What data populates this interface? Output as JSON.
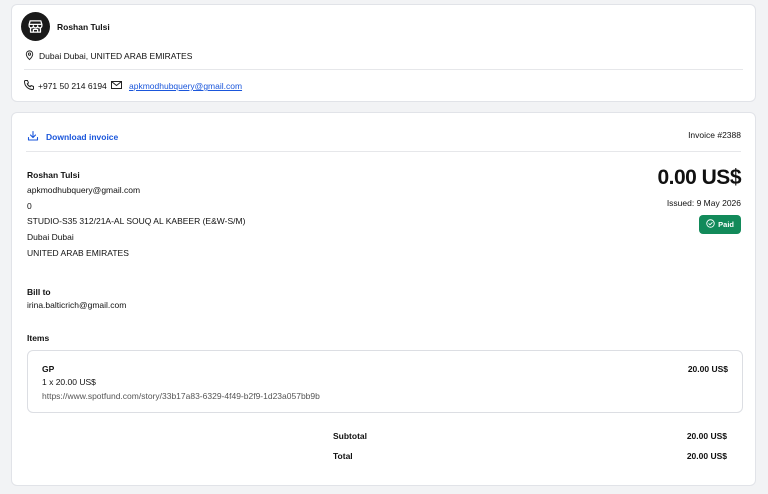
{
  "store": {
    "name": "Roshan Tulsi",
    "location": "Dubai Dubai, UNITED ARAB EMIRATES",
    "phone": "+971 50 214 6194",
    "email": "apkmodhubquery@gmail.com",
    "logo_icon": "store-icon"
  },
  "invoice": {
    "download_label": "Download invoice",
    "number": "Invoice #2388",
    "amount": "0.00 US$",
    "issued": "Issued: 9 May 2026",
    "status": "Paid",
    "status_color": "#128a5a",
    "seller": {
      "name": "Roshan Tulsi",
      "email": "apkmodhubquery@gmail.com",
      "line3": "0",
      "address": "STUDIO-S35 312/21A-AL SOUQ AL KABEER (E&W-S/M)",
      "city": "Dubai Dubai",
      "country": "UNITED ARAB EMIRATES"
    },
    "bill_to": {
      "label": "Bill to",
      "email": "irina.balticrich@gmail.com"
    },
    "items_label": "Items",
    "items": [
      {
        "name": "GP",
        "price": "20.00 US$",
        "qty": "1 x 20.00 US$",
        "url": "https://www.spotfund.com/story/33b17a83-6329-4f49-b2f9-1d23a057bb9b"
      }
    ],
    "subtotal_label": "Subtotal",
    "subtotal": "20.00 US$",
    "total_label": "Total",
    "total": "20.00 US$"
  },
  "accent_color": "#1a56db"
}
